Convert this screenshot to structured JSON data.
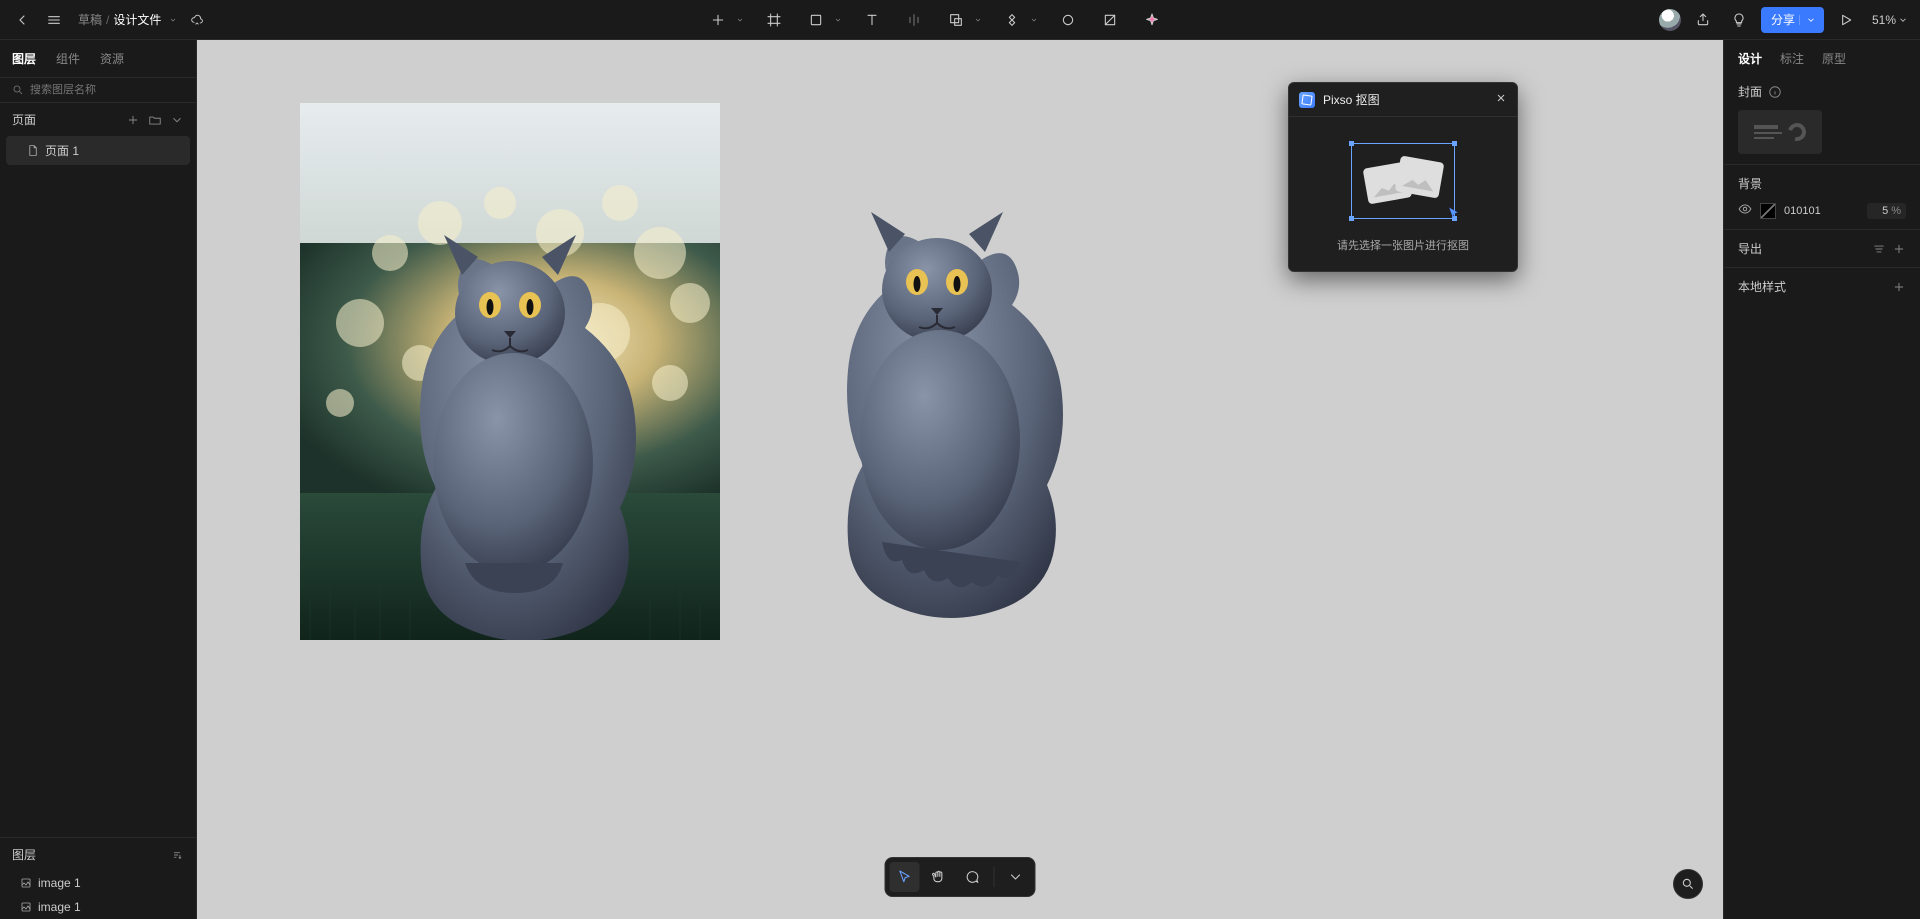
{
  "breadcrumb": {
    "folder": "草稿",
    "file": "设计文件"
  },
  "share_label": "分享",
  "zoom": "51%",
  "left": {
    "tabs": {
      "layers": "图层",
      "components": "组件",
      "assets": "资源"
    },
    "search_placeholder": "搜索图层名称",
    "pages_label": "页面",
    "page1": "页面 1",
    "layers_header": "图层",
    "layer_items": [
      "image 1",
      "image 1"
    ]
  },
  "right": {
    "tabs": {
      "design": "设计",
      "annotate": "标注",
      "prototype": "原型"
    },
    "cover_label": "封面",
    "background_label": "背景",
    "bg_hex": "010101",
    "bg_opacity": "5",
    "bg_opacity_unit": "%",
    "export_label": "导出",
    "local_styles_label": "本地样式"
  },
  "popup": {
    "title": "Pixso 抠图",
    "hint": "请先选择一张图片进行抠图"
  },
  "icons": {
    "back": "back-chevron",
    "menu": "hamburger",
    "cloud": "cloud-sync",
    "plus": "plus",
    "frame": "frame",
    "shape": "rectangle",
    "text": "text",
    "align": "align",
    "boolean": "boolean",
    "corner": "corner-radius",
    "circle": "circle-outline",
    "rect": "image-diff",
    "ai": "ai-sparkle",
    "share": "share-node",
    "bulb": "lightbulb",
    "play": "play",
    "page_icon": "page",
    "layer_image": "image-layer",
    "pointer": "pointer",
    "hand": "hand",
    "comment": "comment",
    "info": "info-circle",
    "settings": "sliders",
    "plus_small": "plus",
    "folder": "folder",
    "chevron": "chevron-down",
    "sort": "sort"
  }
}
